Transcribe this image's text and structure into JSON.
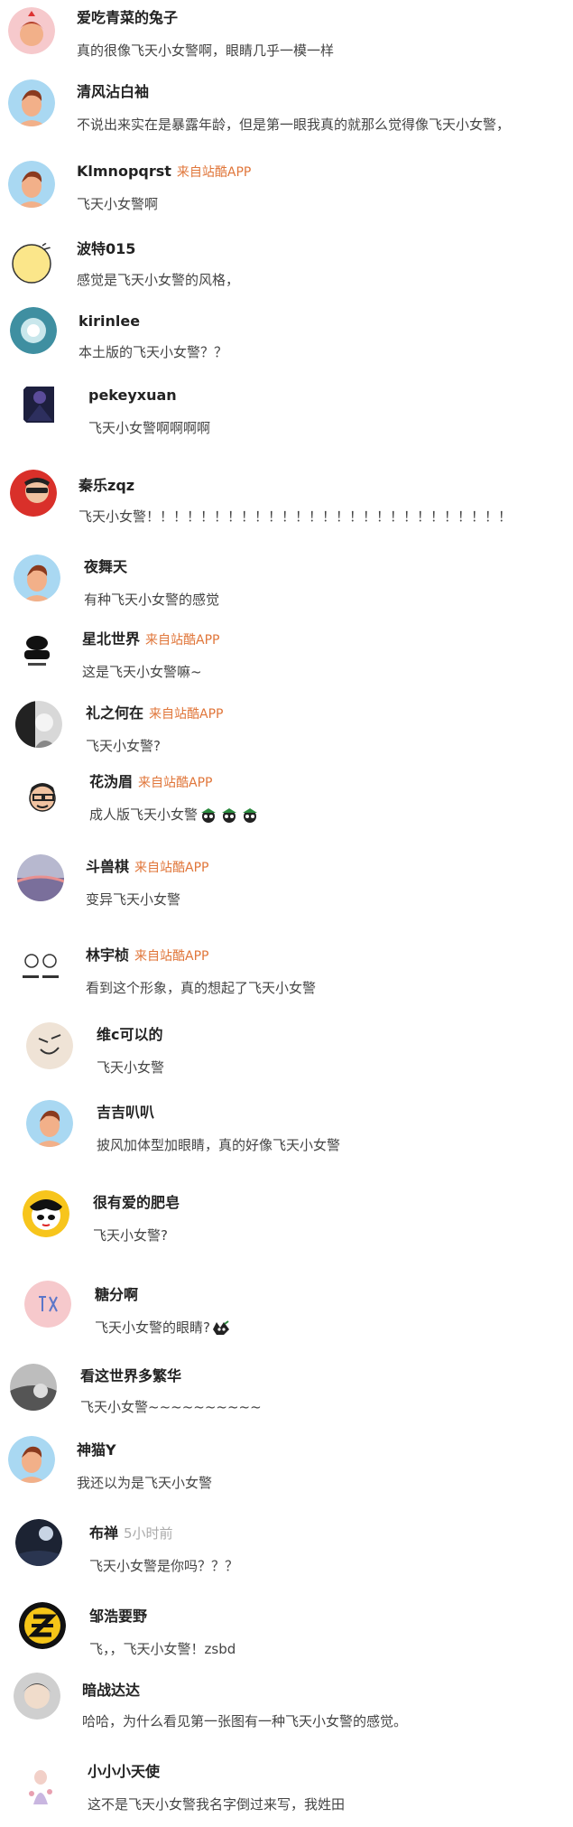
{
  "comments": [
    {
      "user": "爱吃青菜的兔子",
      "text": "真的很像飞天小女警啊，眼睛几乎一模一样",
      "avatar": "avatar-icon",
      "y": 0
    },
    {
      "user": "清风沾白袖",
      "text": "不说出来实在是暴露年龄，但是第一眼我真的就那么觉得像飞天小女警，",
      "avatar": "avatar-icon"
    },
    {
      "user": "Klmnopqrst",
      "source": "来自站酷APP",
      "text": "飞天小女警啊",
      "avatar": "avatar-icon"
    },
    {
      "user": "波特015",
      "text": "感觉是飞天小女警的风格，",
      "avatar": "avatar-icon"
    },
    {
      "user": "kirinlee",
      "text": "本土版的飞天小女警？？",
      "avatar": "avatar-icon"
    },
    {
      "user": "pekeyxuan",
      "text": "飞天小女警啊啊啊啊",
      "avatar": "avatar-icon"
    },
    {
      "user": "秦乐zqz",
      "text": "飞天小女警！！！！！！！！！！！！！！！！！！！！！！！！！！！",
      "avatar": "avatar-icon"
    },
    {
      "user": "夜舞天",
      "text": "有种飞天小女警的感觉",
      "avatar": "avatar-icon"
    },
    {
      "user": "星北世界",
      "source": "来自站酷APP",
      "text": "这是飞天小女警嘛~",
      "avatar": "avatar-icon"
    },
    {
      "user": "礼之何在",
      "source": "来自站酷APP",
      "text": "飞天小女警?",
      "avatar": "avatar-icon"
    },
    {
      "user": "花沩眉",
      "source": "来自站酷APP",
      "text": "成人版飞天小女警",
      "avatar": "avatar-icon"
    },
    {
      "user": "斗兽棋",
      "source": "来自站酷APP",
      "text": "变异飞天小女警",
      "avatar": "avatar-icon"
    },
    {
      "user": "林宇桢",
      "source": "来自站酷APP",
      "text": "看到这个形象，真的想起了飞天小女警",
      "avatar": "avatar-icon"
    },
    {
      "user": "维c可以的",
      "text": "飞天小女警",
      "avatar": "avatar-icon"
    },
    {
      "user": "吉吉叭叭",
      "text": "披风加体型加眼睛，真的好像飞天小女警",
      "avatar": "avatar-icon"
    },
    {
      "user": "很有爱的肥皂",
      "text": "飞天小女警?",
      "avatar": "avatar-icon"
    },
    {
      "user": "糖分啊",
      "text": "飞天小女警的眼睛?",
      "avatar": "avatar-icon"
    },
    {
      "user": "看这世界多繁华",
      "text": "飞天小女警~~~~~~~~~~",
      "avatar": "avatar-icon"
    },
    {
      "user": "神猫Y",
      "text": "我还以为是飞天小女警",
      "avatar": "avatar-icon"
    },
    {
      "user": "布禅",
      "time": "5小时前",
      "text": "飞天小女警是你吗？？？",
      "avatar": "avatar-icon"
    },
    {
      "user": "邹浩要野",
      "text": "飞，，飞天小女警！zsbd",
      "avatar": "avatar-icon"
    },
    {
      "user": "暗战达达",
      "text": "哈哈，为什么看见第一张图有一种飞天小女警的感觉。",
      "avatar": "avatar-icon"
    },
    {
      "user": "小小小天使",
      "text": "这不是飞天小女警我名字倒过来写，我姓田",
      "avatar": "avatar-icon"
    }
  ]
}
